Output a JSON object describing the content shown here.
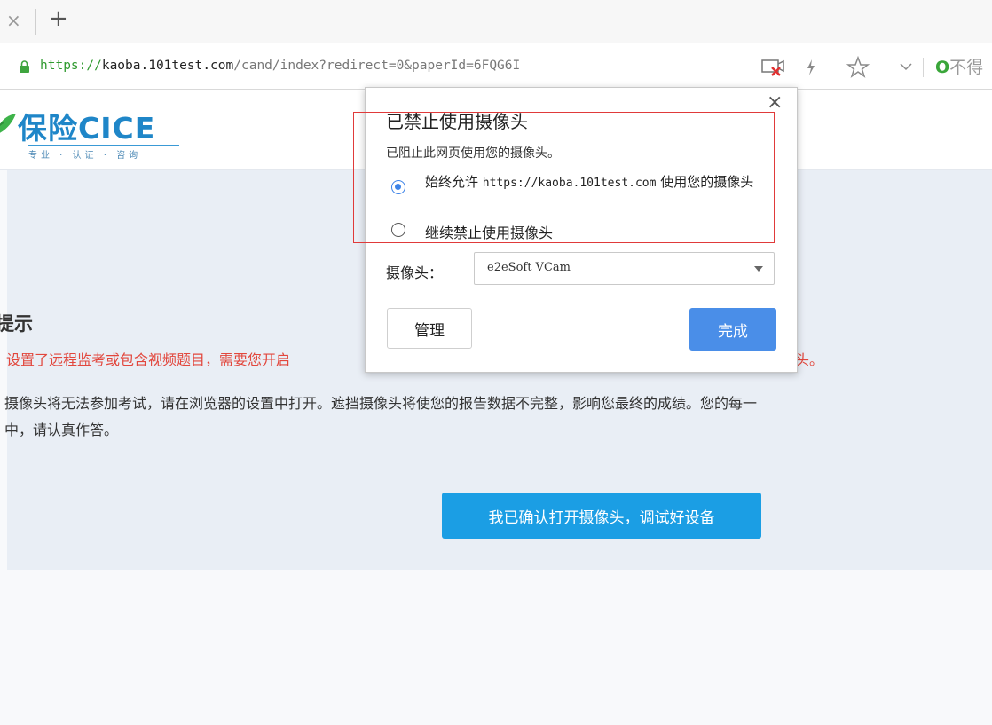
{
  "browser": {
    "tab_close": "×",
    "new_tab": "+",
    "url_scheme": "https://",
    "url_host": "kaoba.101test.com",
    "url_path": "/cand/index?redirect=0&paperId=6FQG6I",
    "search_hint": "不得"
  },
  "site": {
    "logo_text": "保险CICE",
    "logo_sub": "专业 · 认证 · 咨询"
  },
  "page": {
    "title": "提示",
    "warning_start": "设置了远程监考或包含视频题目，需要您开启",
    "warning_end": "头。",
    "desc_line1": "摄像头将无法参加考试，请在浏览器的设置中打开。遮挡摄像头将使您的报告数据不完整，影响您最终的成绩。您的每一",
    "desc_line2": "中，请认真作答。",
    "confirm_button": "我已确认打开摄像头，调试好设备"
  },
  "popup": {
    "close": "×",
    "title": "已禁止使用摄像头",
    "subtitle": "已阻止此网页使用您的摄像头。",
    "option_allow_prefix": "始终允许 ",
    "option_allow_host": "https://kaoba.101test.com",
    "option_allow_suffix": " 使用您的摄像头",
    "option_block": "继续禁止使用摄像头",
    "camera_label": "摄像头：",
    "camera_value": "e2eSoft VCam",
    "manage_button": "管理",
    "done_button": "完成"
  },
  "colors": {
    "accent": "#4a8ee8",
    "brand": "#1f86c8",
    "warning": "#e2473d",
    "highlight": "#e03a3a"
  }
}
